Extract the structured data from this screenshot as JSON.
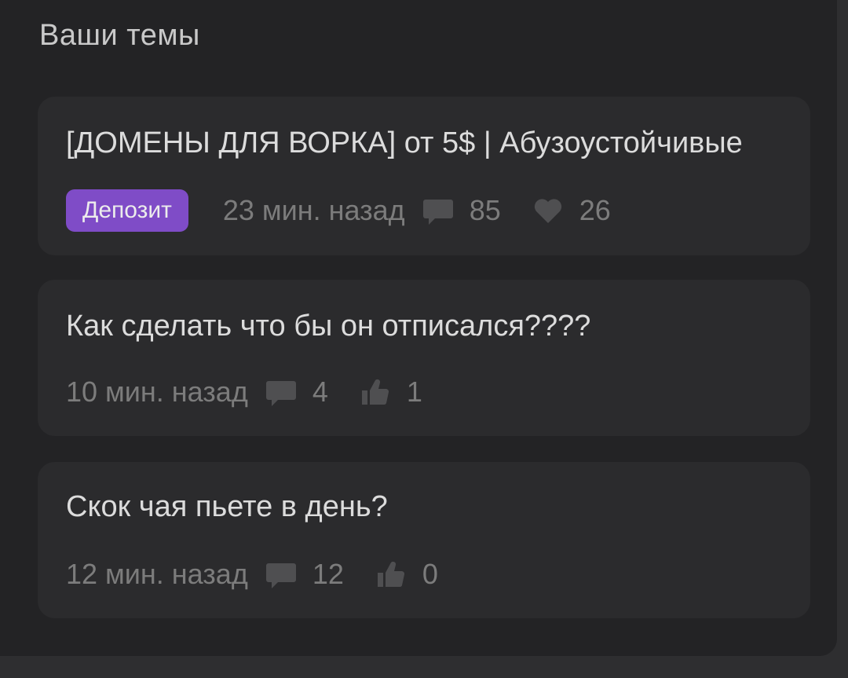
{
  "section": {
    "title": "Ваши темы"
  },
  "topics": [
    {
      "title": "[ДОМЕНЫ ДЛЯ ВОРКА] от 5$ | Абузоустойчивые",
      "badge": "Депозит",
      "time": "23 мин. назад",
      "comments": "85",
      "reaction": "26",
      "reaction_icon": "heart-icon"
    },
    {
      "title": "Как сделать что бы он отписался????",
      "time": "10 мин. назад",
      "comments": "4",
      "reaction": "1",
      "reaction_icon": "thumbs-up-icon"
    },
    {
      "title": "Скок чая пьете в день?",
      "time": "12 мин. назад",
      "comments": "12",
      "reaction": "0",
      "reaction_icon": "thumbs-up-icon"
    }
  ],
  "colors": {
    "background": "#232325",
    "card": "#2b2b2d",
    "badge": "#7f4cc7",
    "title_text": "#dcdcdc",
    "meta_text": "#7c7c7c"
  }
}
